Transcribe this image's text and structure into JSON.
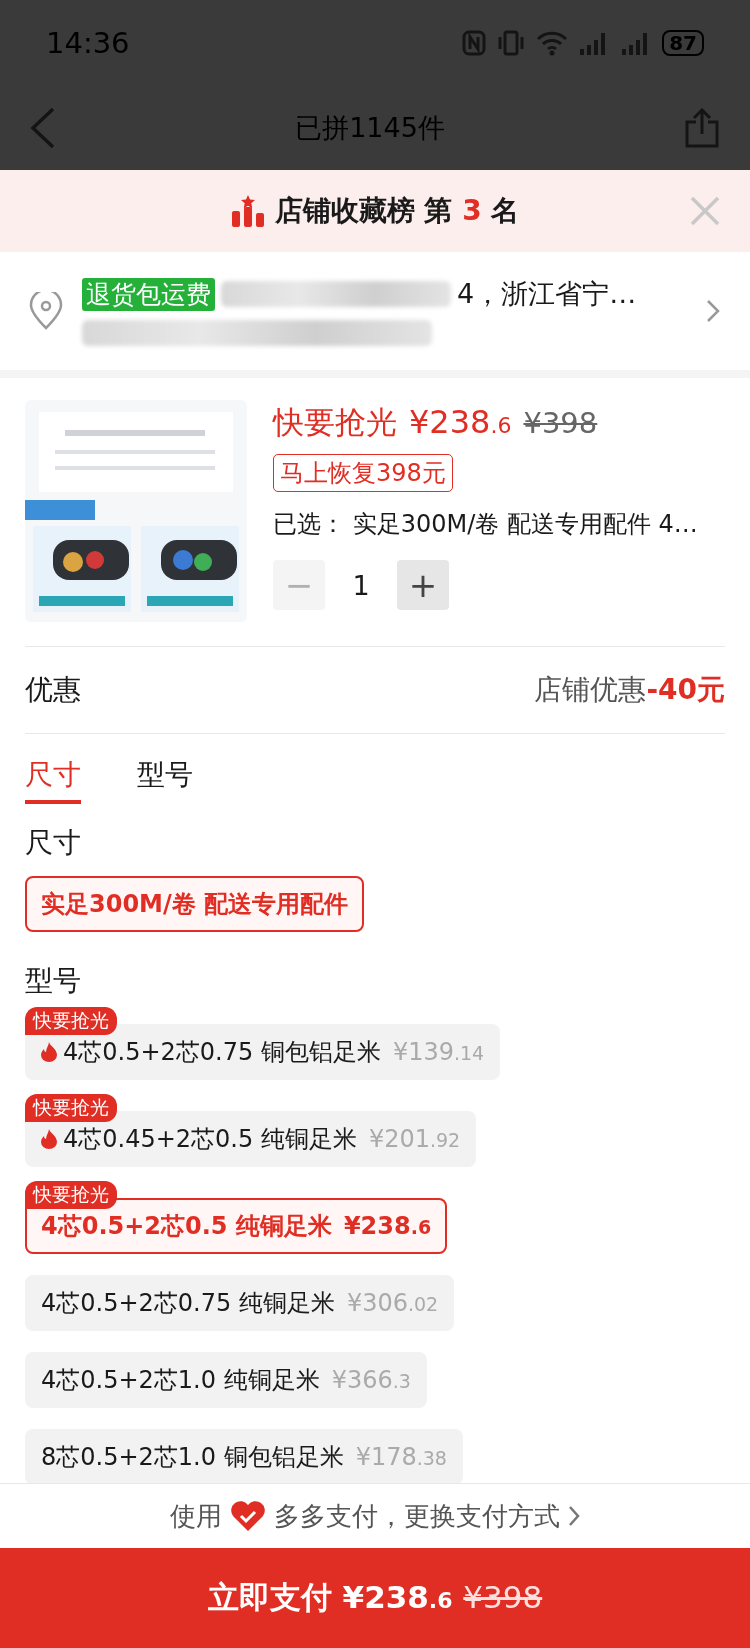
{
  "status_bar": {
    "time": "14:36",
    "battery": "87"
  },
  "nav": {
    "title": "已拼1145件"
  },
  "banner": {
    "text_before": "店铺收藏榜 第",
    "rank": "3",
    "text_after": "名"
  },
  "address": {
    "tag": "退货包运费",
    "line_1": "4，浙江省宁…"
  },
  "product": {
    "promo": "快要抢光",
    "price": "¥238",
    "price_decimal": ".6",
    "original_price": "¥398",
    "restore_tag": "马上恢复398元",
    "selected_label": "已选：",
    "selected_value": "实足300M/卷 配送专用配件 4…",
    "quantity": "1",
    "minus": "−",
    "plus": "+",
    "minus_disabled": true
  },
  "discount": {
    "label": "优惠",
    "value_label": "店铺优惠",
    "value": "-40元"
  },
  "tabs": [
    {
      "label": "尺寸",
      "selected": true
    },
    {
      "label": "型号",
      "selected": false
    }
  ],
  "groups": [
    {
      "title": "尺寸",
      "options": [
        {
          "label": "实足300M/卷 配送专用配件",
          "selected": true
        }
      ]
    },
    {
      "title": "型号",
      "options": [
        {
          "label": "4芯0.5+2芯0.75 铜包铝足米",
          "price": "¥139",
          "price_decimal": ".14",
          "badge": "快要抢光",
          "hot": true,
          "selected": false
        },
        {
          "label": "4芯0.45+2芯0.5 纯铜足米",
          "price": "¥201",
          "price_decimal": ".92",
          "badge": "快要抢光",
          "hot": true,
          "selected": false
        },
        {
          "label": "4芯0.5+2芯0.5 纯铜足米",
          "price": "¥238",
          "price_decimal": ".6",
          "badge": "快要抢光",
          "hot": false,
          "selected": true
        },
        {
          "label": "4芯0.5+2芯0.75 纯铜足米",
          "price": "¥306",
          "price_decimal": ".02",
          "hot": false,
          "selected": false
        },
        {
          "label": "4芯0.5+2芯1.0 纯铜足米",
          "price": "¥366",
          "price_decimal": ".3",
          "hot": false,
          "selected": false
        },
        {
          "label": "8芯0.5+2芯1.0 铜包铝足米",
          "price": "¥178",
          "price_decimal": ".38",
          "hot": false,
          "selected": false
        }
      ]
    }
  ],
  "pay_method": {
    "prefix": "使用",
    "name": "多多支付，更换支付方式"
  },
  "pay_button": {
    "label": "立即支付",
    "price": "¥238",
    "price_decimal": ".6",
    "original_price": "¥398"
  }
}
